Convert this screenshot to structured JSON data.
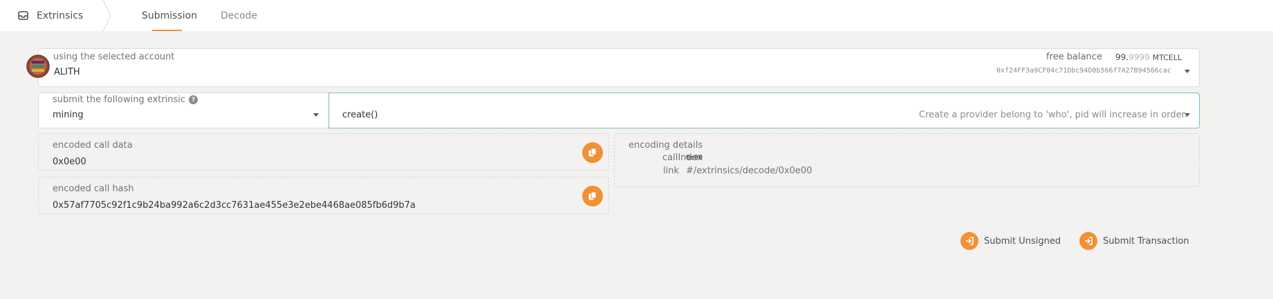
{
  "header": {
    "app_title": "Extrinsics",
    "tabs": [
      {
        "label": "Submission",
        "active": true
      },
      {
        "label": "Decode",
        "active": false
      }
    ]
  },
  "account": {
    "label": "using the selected account",
    "name": "ALITH",
    "free_balance_label": "free balance",
    "balance_int": "99.",
    "balance_dec": "9999",
    "balance_unit": "MTCELL",
    "address": "0xf24FF3a9CF04c71Dbc94D0b566f7A27B94566cac"
  },
  "extrinsic": {
    "label": "submit the following extrinsic",
    "section": "mining",
    "method": "create()",
    "method_description": "Create a provider belong to 'who', pid will increase in order."
  },
  "encoded_call_data": {
    "label": "encoded call data",
    "value": "0x0e00"
  },
  "encoded_call_hash": {
    "label": "encoded call hash",
    "value": "0x57af7705c92f1c9b24ba992a6c2d3cc7631ae455e3e2ebe4468ae085fb6d9b7a"
  },
  "encoding_details": {
    "label": "encoding details",
    "call_index_key": "callIndex",
    "call_index_value": "0e00",
    "link_key": "link",
    "link_value": "#/extrinsics/decode/0x0e00"
  },
  "actions": {
    "submit_unsigned": "Submit Unsigned",
    "submit_transaction": "Submit Transaction"
  },
  "colors": {
    "accent": "#f19135",
    "link": "#1f8bb5",
    "background": "#f3f2f1"
  }
}
